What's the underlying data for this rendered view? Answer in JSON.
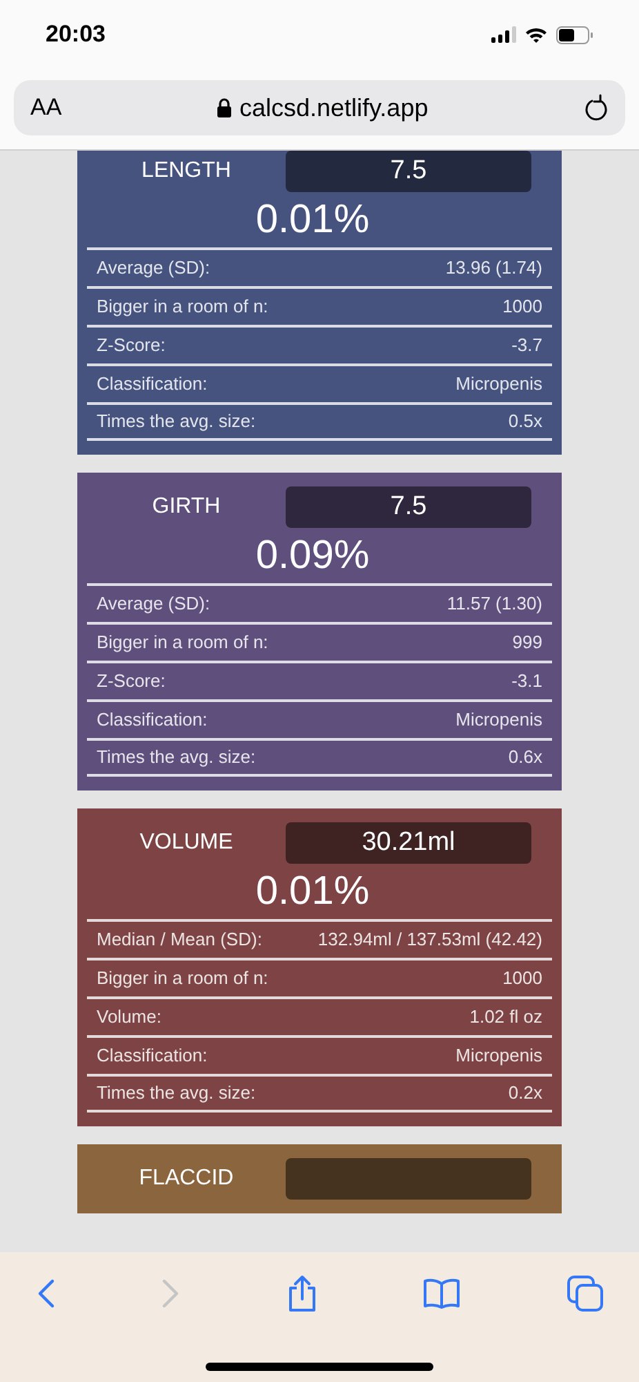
{
  "status_bar": {
    "time": "20:03"
  },
  "address_bar": {
    "text_size_button": "AA",
    "url": "calcsd.netlify.app"
  },
  "cards": [
    {
      "label": "LENGTH",
      "value": "7.5",
      "color": "#46537f",
      "percent": "0.01%",
      "rows": [
        {
          "label": "Average (SD):",
          "value": "13.96 (1.74)"
        },
        {
          "label": "Bigger in a room of n:",
          "value": "1000"
        },
        {
          "label": "Z-Score:",
          "value": "-3.7"
        },
        {
          "label": "Classification:",
          "value": "Micropenis"
        },
        {
          "label": "Times the avg. size:",
          "value": "0.5x"
        }
      ]
    },
    {
      "label": "GIRTH",
      "value": "7.5",
      "color": "#5f4f7c",
      "percent": "0.09%",
      "rows": [
        {
          "label": "Average (SD):",
          "value": "11.57 (1.30)"
        },
        {
          "label": "Bigger in a room of n:",
          "value": "999"
        },
        {
          "label": "Z-Score:",
          "value": "-3.1"
        },
        {
          "label": "Classification:",
          "value": "Micropenis"
        },
        {
          "label": "Times the avg. size:",
          "value": "0.6x"
        }
      ]
    },
    {
      "label": "VOLUME",
      "value": "30.21ml",
      "color": "#7e4445",
      "percent": "0.01%",
      "rows": [
        {
          "label": "Median / Mean (SD):",
          "value": "132.94ml / 137.53ml (42.42)"
        },
        {
          "label": "Bigger in a room of n:",
          "value": "1000"
        },
        {
          "label": "Volume:",
          "value": "1.02 fl oz"
        },
        {
          "label": "Classification:",
          "value": "Micropenis"
        },
        {
          "label": "Times the avg. size:",
          "value": "0.2x"
        }
      ]
    },
    {
      "label": "FLACCID",
      "color": "#8b653e"
    }
  ]
}
